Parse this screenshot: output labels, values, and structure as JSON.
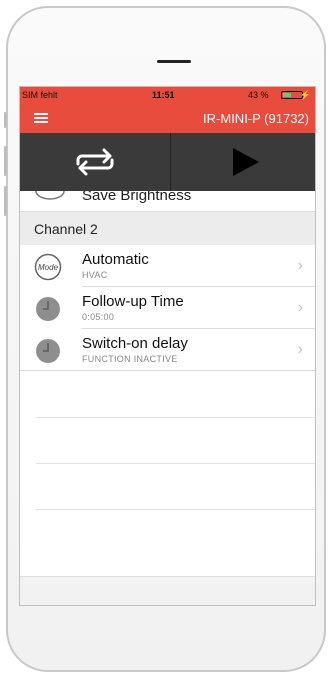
{
  "status_bar": {
    "carrier": "SIM fehlt",
    "time": "11:51",
    "battery_percent": "43 %",
    "battery_level": 0.43
  },
  "nav": {
    "menu_icon": "hamburger-icon",
    "device_title": "IR-MINI-P  (91732)"
  },
  "toolbar": {
    "left_icon": "repeat-icon",
    "right_icon": "play-icon"
  },
  "list": {
    "partial_item_label": "Save Brightness",
    "section_header": "Channel 2",
    "items": [
      {
        "title": "Automatic",
        "subtitle": "HVAC",
        "icon": "mode-icon"
      },
      {
        "title": "Follow-up Time",
        "subtitle": "0:05:00",
        "icon": "clock-icon"
      },
      {
        "title": "Switch-on delay",
        "subtitle": "FUNCTION INACTIVE",
        "icon": "clock-icon"
      }
    ]
  },
  "colors": {
    "accent": "#e84c3d",
    "toolbar": "#3a3a3a"
  }
}
